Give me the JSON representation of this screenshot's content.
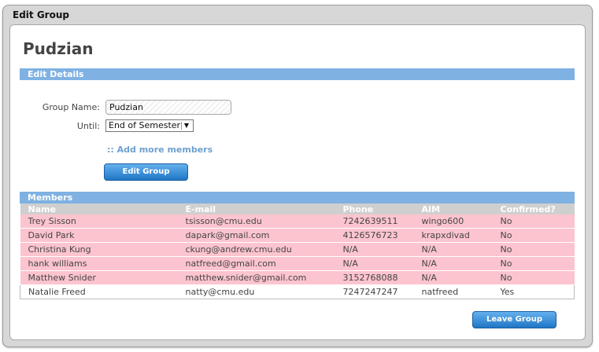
{
  "window": {
    "title": "Edit Group"
  },
  "group": {
    "name": "Pudzian"
  },
  "edit_details": {
    "section_title": "Edit Details",
    "group_name_label": "Group Name:",
    "group_name_value": "Pudzian",
    "until_label": "Until:",
    "until_value": "End of Semester",
    "add_members_link": ":: Add more members",
    "edit_button": "Edit Group"
  },
  "members": {
    "section_title": "Members",
    "columns": [
      "Name",
      "E-mail",
      "Phone",
      "AIM",
      "Confirmed?"
    ],
    "rows": [
      {
        "name": "Trey Sisson",
        "email": "tsisson@cmu.edu",
        "phone": "7242639511",
        "aim": "wingo600",
        "confirmed": "No"
      },
      {
        "name": "David Park",
        "email": "dapark@gmail.com",
        "phone": "4126576723",
        "aim": "krapxdivad",
        "confirmed": "No"
      },
      {
        "name": "Christina Kung",
        "email": "ckung@andrew.cmu.edu",
        "phone": "N/A",
        "aim": "N/A",
        "confirmed": "No"
      },
      {
        "name": "hank williams",
        "email": "natfreed@gmail.com",
        "phone": "N/A",
        "aim": "N/A",
        "confirmed": "No"
      },
      {
        "name": "Matthew Snider",
        "email": "matthew.snider@gmail.com",
        "phone": "3152768088",
        "aim": "N/A",
        "confirmed": "No"
      },
      {
        "name": "Natalie Freed",
        "email": "natty@cmu.edu",
        "phone": "7247247247",
        "aim": "natfreed",
        "confirmed": "Yes"
      }
    ]
  },
  "leave_button": "Leave Group",
  "colors": {
    "accent": "#7fb1e3",
    "pending_row": "#fcc4cf",
    "button": "#1f76c6"
  }
}
